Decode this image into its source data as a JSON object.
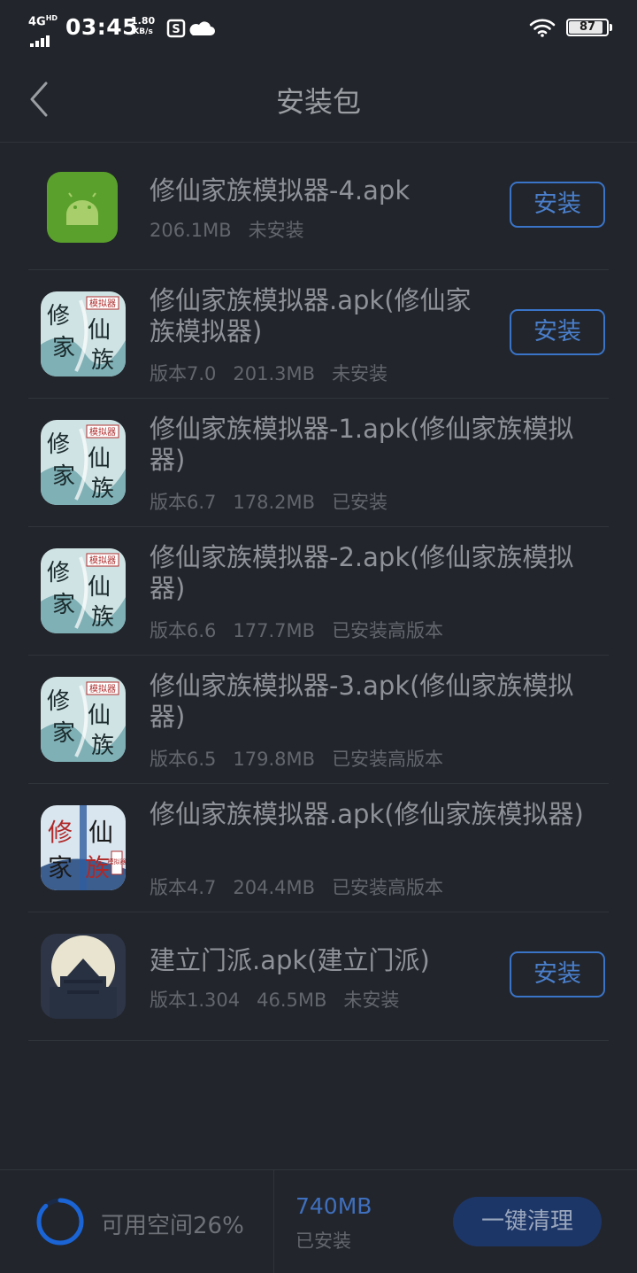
{
  "status_bar": {
    "network": "4G",
    "network_sup": "HD",
    "time": "03:45",
    "speed_value": "1.80",
    "speed_unit": "KB/s",
    "battery": "87",
    "icons": [
      "s-notification-icon",
      "cloud-icon",
      "wifi-icon",
      "battery-icon"
    ]
  },
  "header": {
    "title": "安装包",
    "back_icon": "chevron-left-icon"
  },
  "packages": [
    {
      "name": "修仙家族模拟器-4.apk",
      "version": "",
      "size": "206.1MB",
      "status": "未安装",
      "button": "安装",
      "icon": "android-icon",
      "icon_color": "#5aa02c"
    },
    {
      "name": "修仙家族模拟器.apk(修仙家族模拟器)",
      "version": "版本7.0",
      "size": "201.3MB",
      "status": "未安装",
      "button": "安装",
      "icon": "game-art-icon",
      "seal_text": "模拟器",
      "art_chars": [
        "修",
        "仙",
        "家",
        "族"
      ]
    },
    {
      "name": "修仙家族模拟器-1.apk(修仙家族模拟器)",
      "version": "版本6.7",
      "size": "178.2MB",
      "status": "已安装",
      "button": "",
      "icon": "game-art-icon",
      "seal_text": "模拟器",
      "art_chars": [
        "修",
        "仙",
        "家",
        "族"
      ]
    },
    {
      "name": "修仙家族模拟器-2.apk(修仙家族模拟器)",
      "version": "版本6.6",
      "size": "177.7MB",
      "status": "已安装高版本",
      "button": "",
      "icon": "game-art-icon",
      "seal_text": "模拟器",
      "art_chars": [
        "修",
        "仙",
        "家",
        "族"
      ]
    },
    {
      "name": "修仙家族模拟器-3.apk(修仙家族模拟器)",
      "version": "版本6.5",
      "size": "179.8MB",
      "status": "已安装高版本",
      "button": "",
      "icon": "game-art-icon",
      "seal_text": "模拟器",
      "art_chars": [
        "修",
        "仙",
        "家",
        "族"
      ]
    },
    {
      "name": "修仙家族模拟器.apk(修仙家族模拟器)",
      "version": "版本4.7",
      "size": "204.4MB",
      "status": "已安装高版本",
      "button": "",
      "icon": "game-art-icon-v2",
      "seal_text": "模拟器",
      "art_chars": [
        "修",
        "仙",
        "家",
        "族"
      ]
    },
    {
      "name": "建立门派.apk(建立门派)",
      "version": "版本1.304",
      "size": "46.5MB",
      "status": "未安装",
      "button": "安装",
      "icon": "palace-moon-icon"
    }
  ],
  "footer": {
    "storage_label": "可用空间26%",
    "storage_free_fraction": 0.26,
    "installed_size": "740MB",
    "installed_label": "已安装",
    "clean_button": "一键清理",
    "ring_color": "#1a64d6"
  }
}
